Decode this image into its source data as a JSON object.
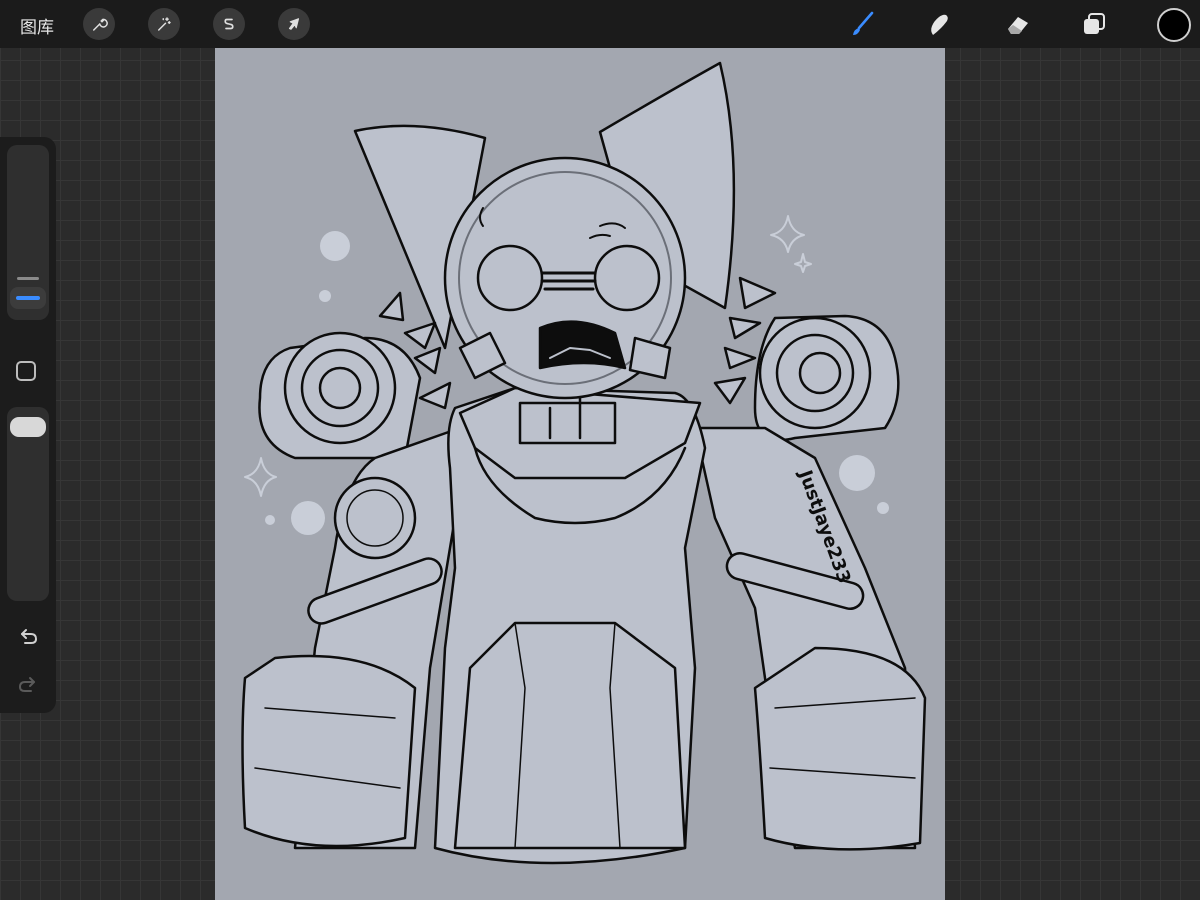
{
  "topbar": {
    "gallery_label": "图库",
    "left_tools": [
      "wrench-icon",
      "magic-wand-icon",
      "selection-s-icon",
      "arrow-transform-icon"
    ],
    "right_tools": [
      "brush-icon",
      "smudge-icon",
      "eraser-icon",
      "layers-icon"
    ],
    "active_tool": "brush-icon",
    "current_color": "#000000",
    "accent_color": "#3a8cff"
  },
  "sidebar": {
    "controls": [
      "brush-size-slider",
      "modify-button",
      "opacity-slider",
      "undo-icon",
      "redo-icon"
    ]
  },
  "canvas": {
    "background_color": "#a3a7b0",
    "signature_text": "JustJaye233"
  }
}
